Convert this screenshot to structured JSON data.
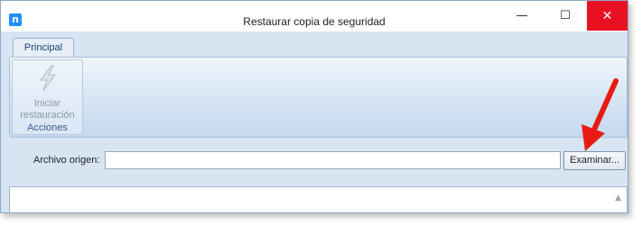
{
  "window": {
    "title": "Restaurar copia de seguridad",
    "app_icon_letter": "n",
    "minimize_symbol": "—",
    "maximize_symbol": "☐",
    "close_symbol": "✕"
  },
  "ribbon": {
    "tabs": [
      {
        "label": "Principal",
        "selected": true
      }
    ],
    "groups": [
      {
        "label": "Acciones",
        "buttons": [
          {
            "label_line1": "Iniciar",
            "label_line2": "restauración",
            "icon": "lightning-bolt-icon",
            "enabled": false
          }
        ]
      }
    ]
  },
  "form": {
    "source_label": "Archivo origen:",
    "source_value": "",
    "browse_label": "Examinar..."
  },
  "annotation": {
    "arrow_color": "#e81b14"
  },
  "colors": {
    "close_button": "#e81123",
    "window_bg": "#d7e4f2"
  }
}
